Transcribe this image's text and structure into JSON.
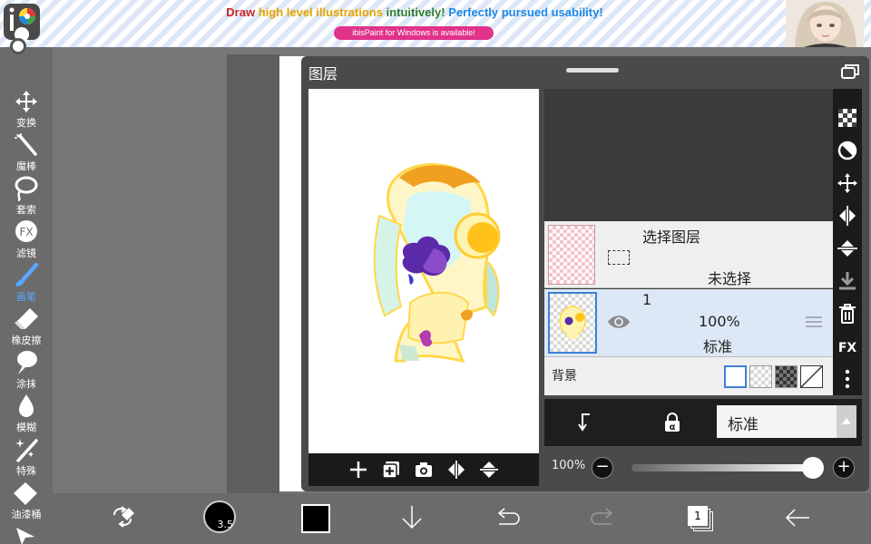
{
  "ad": {
    "headline": {
      "p1": "Draw ",
      "p2": "high level illustrations",
      "p3": " intuitively!",
      "p4": " Perfectly pursued usability!"
    },
    "pill": "ibisPaint for Windows is available!"
  },
  "left_toolbar": {
    "active": "brush",
    "tools": [
      {
        "id": "transform",
        "label": "变换",
        "icon": "move-icon"
      },
      {
        "id": "magic-wand",
        "label": "魔棒",
        "icon": "magic-wand-icon"
      },
      {
        "id": "lasso",
        "label": "套索",
        "icon": "lasso-icon"
      },
      {
        "id": "filter",
        "label": "滤镜",
        "icon": "fx-icon"
      },
      {
        "id": "brush",
        "label": "画笔",
        "icon": "brush-icon"
      },
      {
        "id": "eraser",
        "label": "橡皮擦",
        "icon": "eraser-icon"
      },
      {
        "id": "smudge",
        "label": "涂抹",
        "icon": "smudge-icon"
      },
      {
        "id": "blur",
        "label": "模糊",
        "icon": "drop-icon"
      },
      {
        "id": "special",
        "label": "特殊",
        "icon": "sparkle-wand-icon"
      },
      {
        "id": "fill",
        "label": "油漆桶",
        "icon": "bucket-icon"
      }
    ]
  },
  "layer_panel": {
    "title": "图层",
    "selection_layer": {
      "name": "选择图层",
      "status": "未选择"
    },
    "layers": [
      {
        "number": "1",
        "opacity": "100%",
        "blend": "标准",
        "visible": true
      }
    ],
    "background": {
      "label": "背景"
    },
    "blend_mode": "标准",
    "opacity": {
      "label": "100%",
      "value": 1.0
    }
  },
  "bottom_toolbar": {
    "brush_size": "3.5",
    "current_color": "#000000",
    "layer_count": "1"
  },
  "colors": {
    "accent": "#58a8ff",
    "panel": "#4a4a4a",
    "toolbar": "#6b6b6b",
    "layer_selected": "#dce8f6"
  }
}
